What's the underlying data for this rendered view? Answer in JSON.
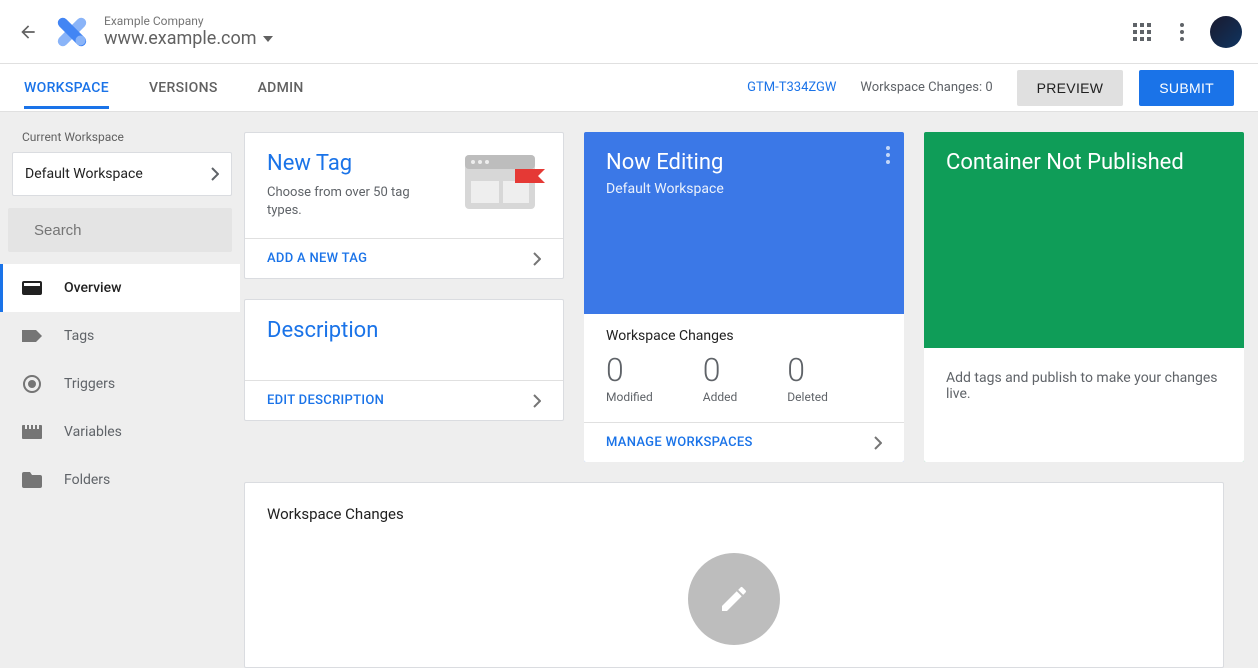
{
  "header": {
    "company": "Example Company",
    "domain": "www.example.com"
  },
  "nav": {
    "tabs": [
      "WORKSPACE",
      "VERSIONS",
      "ADMIN"
    ],
    "container_id": "GTM-T334ZGW",
    "ws_changes": "Workspace Changes: 0",
    "preview": "PREVIEW",
    "submit": "SUBMIT"
  },
  "sidebar": {
    "current_workspace_label": "Current Workspace",
    "workspace_name": "Default Workspace",
    "search_placeholder": "Search",
    "items": [
      {
        "label": "Overview"
      },
      {
        "label": "Tags"
      },
      {
        "label": "Triggers"
      },
      {
        "label": "Variables"
      },
      {
        "label": "Folders"
      }
    ]
  },
  "cards": {
    "new_tag": {
      "title": "New Tag",
      "subtitle": "Choose from over 50 tag types.",
      "action": "ADD A NEW TAG"
    },
    "description": {
      "title": "Description",
      "action": "EDIT DESCRIPTION"
    },
    "now_editing": {
      "title": "Now Editing",
      "subtitle": "Default Workspace",
      "stats_title": "Workspace Changes",
      "modified_n": "0",
      "modified_l": "Modified",
      "added_n": "0",
      "added_l": "Added",
      "deleted_n": "0",
      "deleted_l": "Deleted",
      "action": "MANAGE WORKSPACES"
    },
    "container": {
      "title": "Container Not Published",
      "subtitle": "Add tags and publish to make your changes live."
    }
  },
  "wide": {
    "title": "Workspace Changes"
  }
}
